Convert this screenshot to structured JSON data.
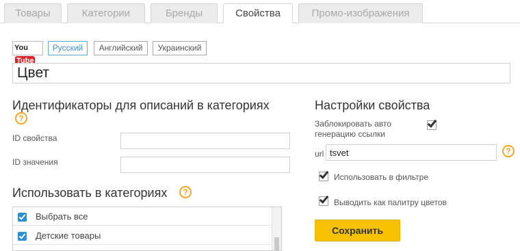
{
  "tabs": [
    {
      "label": "Товары",
      "active": false
    },
    {
      "label": "Категории",
      "active": false
    },
    {
      "label": "Бренды",
      "active": false
    },
    {
      "label": "Свойства",
      "active": true
    },
    {
      "label": "Промо-изображения",
      "active": false
    }
  ],
  "youtube": {
    "you": "You",
    "tube": "Tube"
  },
  "languages": [
    {
      "label": "Русский",
      "active": true
    },
    {
      "label": "Английский",
      "active": false
    },
    {
      "label": "Украинский",
      "active": false
    }
  ],
  "property_name": "Цвет",
  "ids_section": {
    "title": "Идентификаторы для описаний в категориях",
    "help": "?",
    "prop_id_label": "ID свойства",
    "prop_id_value": "",
    "value_id_label": "ID значения",
    "value_id_value": ""
  },
  "settings": {
    "title": "Настройки свойства",
    "lock_label": "Заблокировать авто генерацию ссылки",
    "lock_checked": true,
    "url_label": "url",
    "url_value": "tsvet",
    "url_help": "?",
    "filter_label": "Использовать в фильтре",
    "filter_checked": true,
    "palette_label": "Выводить как палитру цветов",
    "palette_checked": true,
    "save_label": "Сохранить"
  },
  "use_section": {
    "title": "Использовать в категориях",
    "help": "?",
    "items": [
      {
        "label": "Выбрать все",
        "checked": true
      },
      {
        "label": "Детские товары",
        "checked": true
      }
    ]
  },
  "colors": {
    "accent_button": "#f8c200",
    "help_icon": "#f5a623",
    "checkbox_blue": "#2b8fd6",
    "active_lang": "#3a8fd0"
  }
}
